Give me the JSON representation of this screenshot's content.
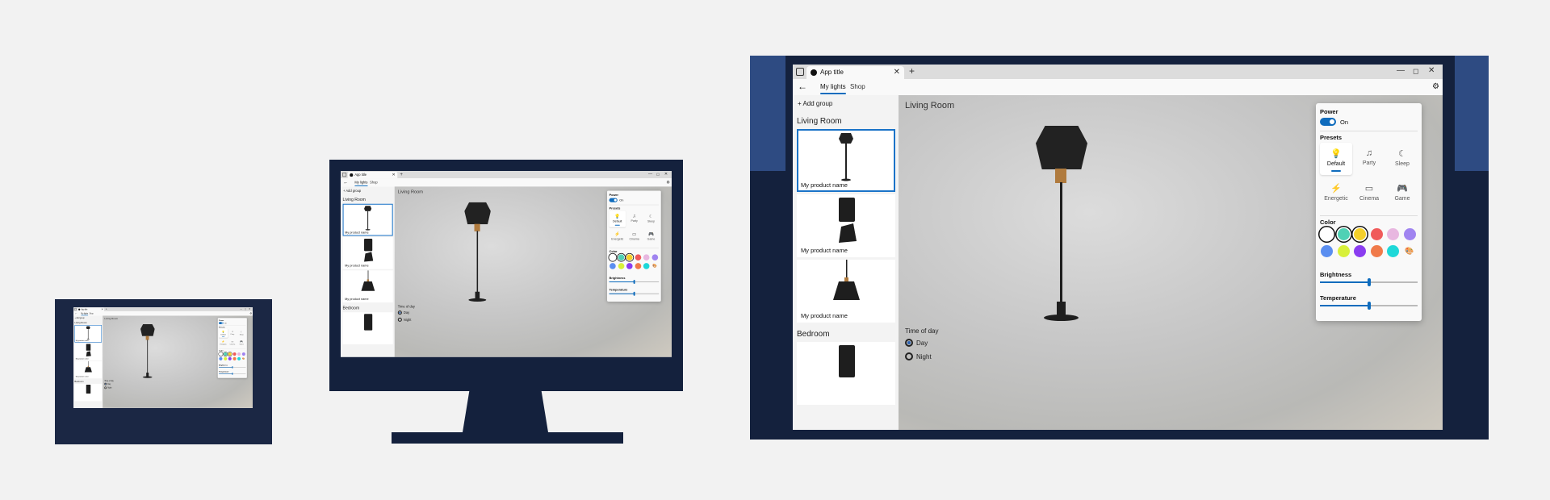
{
  "app": {
    "tab_title": "App title",
    "tab_close": "✕",
    "tab_add": "+",
    "window_controls": {
      "minimize": "—",
      "maximize": "◻",
      "close": "✕"
    },
    "back_glyph": "←",
    "nav_tabs": [
      "My lights",
      "Shop"
    ],
    "settings_glyph": "⚙",
    "add_group": "+ Add group",
    "groups": [
      {
        "title": "Living Room",
        "items": [
          {
            "name": "My product name",
            "selected": true,
            "icon": "floor-lamp"
          },
          {
            "name": "My product name",
            "selected": false,
            "icon": "bedside-lamp"
          },
          {
            "name": "My product name",
            "selected": false,
            "icon": "hanging-lamp"
          }
        ]
      },
      {
        "title": "Bedroom",
        "items": []
      }
    ],
    "stage_title": "Living Room",
    "time_of_day": {
      "title": "Time of day",
      "options": [
        {
          "label": "Day",
          "selected": true
        },
        {
          "label": "Night",
          "selected": false
        }
      ]
    },
    "panel": {
      "power_label": "Power",
      "power_state": "On",
      "presets_label": "Presets",
      "presets": [
        {
          "label": "Default",
          "icon": "bulb-icon",
          "glyph": "💡",
          "selected": true
        },
        {
          "label": "Party",
          "icon": "music-icon",
          "glyph": "♫",
          "selected": false
        },
        {
          "label": "Sleep",
          "icon": "moon-icon",
          "glyph": "☾",
          "selected": false
        },
        {
          "label": "Energetic",
          "icon": "lightning-icon",
          "glyph": "⚡",
          "selected": false
        },
        {
          "label": "Cinema",
          "icon": "screen-icon",
          "glyph": "▭",
          "selected": false
        },
        {
          "label": "Game",
          "icon": "gamepad-icon",
          "glyph": "🎮",
          "selected": false
        }
      ],
      "color_label": "Color",
      "colors": [
        "#ffffff",
        "#4fd1b5",
        "#f5d02a",
        "#f05a5a",
        "#e8b7e0",
        "#a084f0",
        "#5a8ef0",
        "#d8f03a",
        "#8a3df0",
        "#f07a4a",
        "#1ed8d8"
      ],
      "selected_colors": [
        0,
        1,
        2
      ],
      "custom_color_glyph": "🎨",
      "brightness_label": "Brightness",
      "brightness": 0.5,
      "temperature_label": "Temperature",
      "temperature": 0.5
    }
  },
  "colors": {
    "device": "#14213d",
    "band": "#2e4b82",
    "accent": "#0f6cbd"
  }
}
